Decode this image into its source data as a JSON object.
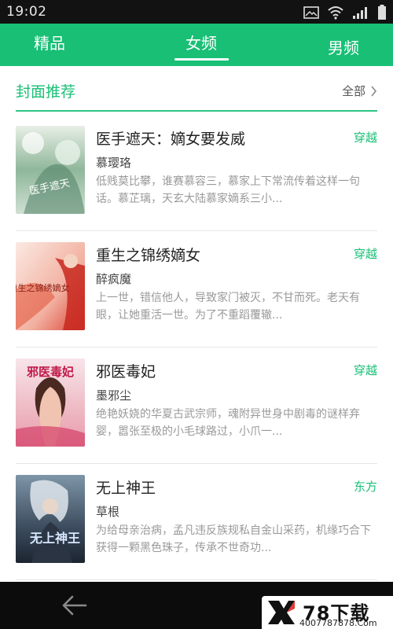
{
  "status_bar": {
    "time": "19:02"
  },
  "tabs": [
    {
      "label": "精品"
    },
    {
      "label": "女频"
    },
    {
      "label": "男频"
    }
  ],
  "active_tab_index": 1,
  "section": {
    "title": "封面推荐",
    "more_label": "全部"
  },
  "books": [
    {
      "title": "医手遮天：嫡女要发威",
      "tag": "穿越",
      "author": "慕璎珞",
      "description": "低贱莫比攀，谁赛慕容三，慕家上下常流传着这样一句话。慕芷璃，天玄大陆慕家嫡系三小...",
      "cover_text": "医手遮天"
    },
    {
      "title": "重生之锦绣嫡女",
      "tag": "穿越",
      "author": "醉疯魔",
      "description": "上一世，错信他人，导致家门被灭，不甘而死。老天有眼，让她重活一世。为了不重蹈覆辙...",
      "cover_text": "重生之锦绣嫡女"
    },
    {
      "title": "邪医毒妃",
      "tag": "穿越",
      "author": "墨邪尘",
      "description": "绝艳妖娆的华夏古武宗师，魂附异世身中剧毒的谜样弃婴，嚣张至极的小毛球路过，小爪一...",
      "cover_text": "邪医毒妃"
    },
    {
      "title": "无上神王",
      "tag": "东方",
      "author": "草根",
      "description": "为给母亲治病，孟凡违反族规私自金山采药，机缘巧合下获得一颗黑色珠子，传承不世奇功...",
      "cover_text": "无上神王"
    }
  ],
  "watermark": {
    "brand": "78下载",
    "url": "4007787878.Com"
  },
  "colors": {
    "accent": "#18bf75",
    "status_bar": "#121212",
    "nav_bar": "#0c0c0c"
  }
}
